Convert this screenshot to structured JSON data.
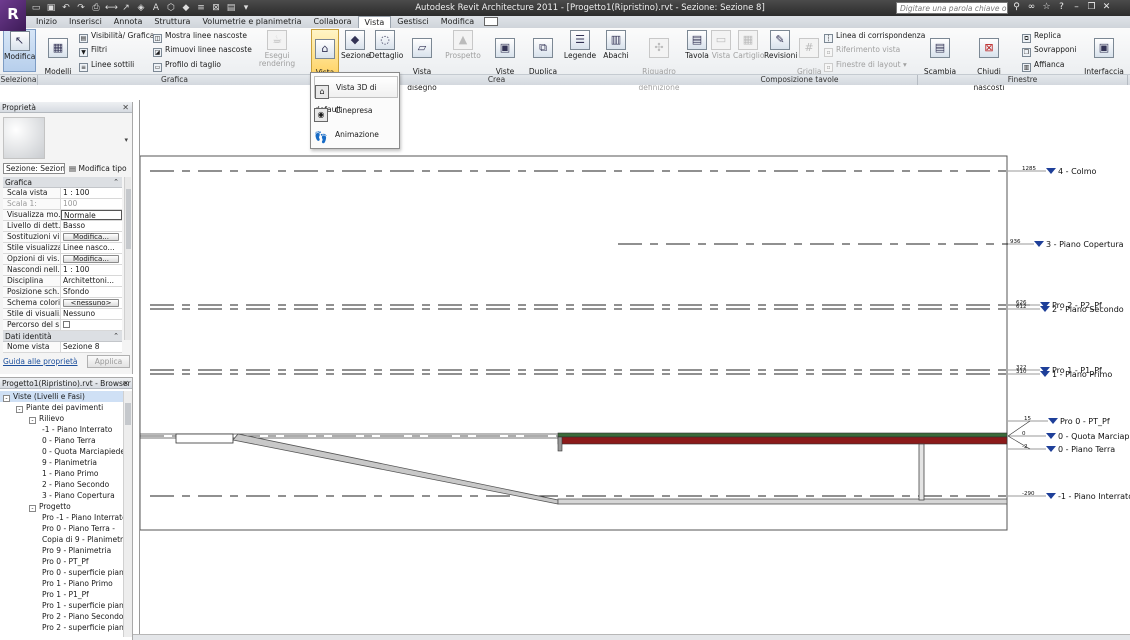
{
  "titlebar": {
    "logo": "R",
    "title": "Autodesk Revit Architecture 2011 - [Progetto1(Ripristino).rvt - Sezione: Sezione 8]",
    "help_placeholder": "Digitare una parola chiave o una frase"
  },
  "tabs": [
    {
      "label": "Inizio"
    },
    {
      "label": "Inserisci"
    },
    {
      "label": "Annota"
    },
    {
      "label": "Struttura"
    },
    {
      "label": "Volumetrie e planimetria"
    },
    {
      "label": "Collabora"
    },
    {
      "label": "Vista",
      "active": true
    },
    {
      "label": "Gestisci"
    },
    {
      "label": "Modifica"
    }
  ],
  "ribbon": {
    "modifica": "Modifica",
    "modelli_vista": "Modelli\nvista",
    "visibilita": "Visibilità/ Grafica",
    "filtri": "Filtri",
    "linee_sottili": "Linee sottili",
    "mostra_linee": "Mostra linee nascoste",
    "rimuovi_linee": "Rimuovi linee nascoste",
    "profilo_taglio": "Profilo di taglio",
    "esegui_rendering": "Esegui rendering",
    "vista3d": "Vista\n3D",
    "sezione": "Sezione",
    "dettaglio": "Dettaglio",
    "vista_disegno": "Vista\ndi disegno",
    "prospetto": "Prospetto",
    "viste_pianta": "Viste\ndi pianta",
    "duplica_vista": "Duplica\nvista",
    "legende": "Legende",
    "abachi": "Abachi",
    "riquadro": "Riquadro\ndi definizione",
    "tavola": "Tavola",
    "vista": "Vista",
    "cartiglio": "Cartiglio",
    "revisioni": "Revisioni",
    "griglia_guida": "Griglia\nguida",
    "linea_corrispondenza": "Linea di corrispondenza",
    "riferimento_vista": "Riferimento vista",
    "finestre_layout": "Finestre di layout",
    "scambia_finestre": "Scambia\nfinestre",
    "chiudi_elementi": "Chiudi\nelementi nascosti",
    "replica": "Replica",
    "sovrapponi": "Sovrapponi",
    "affianca": "Affianca",
    "interfaccia_utente": "Interfaccia\nutente"
  },
  "groups": {
    "seleziona": "Seleziona",
    "grafica": "Grafica",
    "crea": "Crea",
    "composizione": "Composizione tavole",
    "finestre": "Finestre"
  },
  "dropdown": {
    "items": [
      "Vista 3D di default",
      "Cinepresa",
      "Animazione"
    ]
  },
  "properties": {
    "title": "Proprietà",
    "type_select": "Sezione: Sezion",
    "edit_type": "Modifica tipo",
    "section_graphics": "Grafica",
    "rows": [
      {
        "k": "Scala vista",
        "v": "1 : 100"
      },
      {
        "k": "Scala 1:",
        "v": "100"
      },
      {
        "k": "Visualizza mo...",
        "v": "Normale"
      },
      {
        "k": "Livello di dett...",
        "v": "Basso"
      },
      {
        "k": "Sostituzioni vi...",
        "v": "Modifica..."
      },
      {
        "k": "Stile visualizza...",
        "v": "Linee nasco..."
      },
      {
        "k": "Opzioni di vis...",
        "v": "Modifica..."
      },
      {
        "k": "Nascondi nell...",
        "v": "1 : 100"
      },
      {
        "k": "Disciplina",
        "v": "Architettoni..."
      },
      {
        "k": "Posizione sch...",
        "v": "Sfondo"
      },
      {
        "k": "Schema colori",
        "v": "<nessuno>"
      },
      {
        "k": "Stile di visuali...",
        "v": "Nessuno"
      },
      {
        "k": "Percorso del s...",
        "v": ""
      }
    ],
    "section_identity": "Dati identità",
    "identity_rows": [
      {
        "k": "Nome vista",
        "v": "Sezione 8"
      }
    ],
    "help_link": "Guida alle proprietà",
    "apply": "Applica"
  },
  "browser": {
    "title": "Progetto1(Ripristino).rvt - Browser d...",
    "nodes": [
      {
        "label": "Viste (Livelli e Fasi)",
        "depth": 0,
        "toggle": "-"
      },
      {
        "label": "Piante dei pavimenti",
        "depth": 1,
        "toggle": "-"
      },
      {
        "label": "Rilievo",
        "depth": 2,
        "toggle": "-"
      },
      {
        "label": "-1 - Piano Interrato",
        "depth": 3
      },
      {
        "label": "0 - Piano Terra",
        "depth": 3
      },
      {
        "label": "0 - Quota Marciapiede",
        "depth": 3
      },
      {
        "label": "9 - Planimetria",
        "depth": 3
      },
      {
        "label": "1 - Piano Primo",
        "depth": 3
      },
      {
        "label": "2 - Piano Secondo",
        "depth": 3
      },
      {
        "label": "3 - Piano Copertura",
        "depth": 3
      },
      {
        "label": "Progetto",
        "depth": 2,
        "toggle": "-"
      },
      {
        "label": "Pro -1 - Piano Interrato",
        "depth": 3
      },
      {
        "label": "Pro 0 - Piano Terra -",
        "depth": 3
      },
      {
        "label": "Copia di 9 - Planimetria",
        "depth": 3
      },
      {
        "label": "Pro  9 - Planimetria",
        "depth": 3
      },
      {
        "label": "Pro 0 - PT_Pf",
        "depth": 3
      },
      {
        "label": "Pro 0 - superficie piano",
        "depth": 3
      },
      {
        "label": "Pro 1 - Piano Primo",
        "depth": 3
      },
      {
        "label": "Pro 1 - P1_Pf",
        "depth": 3
      },
      {
        "label": "Pro 1 - superficie piano",
        "depth": 3
      },
      {
        "label": "Pro 2 - Piano Secondo",
        "depth": 3
      },
      {
        "label": "Pro 2 - superficie piano",
        "depth": 3
      }
    ]
  },
  "levels": [
    {
      "name": "4 - Colmo",
      "elev": "1285"
    },
    {
      "name": "3 - Piano Copertura",
      "elev": "936"
    },
    {
      "name": "Pro 2 - P2_Pf",
      "elev": "626"
    },
    {
      "name": "2 - Piano Secondo",
      "elev": "612"
    },
    {
      "name": "Pro 1 - P1_Pf",
      "elev": "322"
    },
    {
      "name": "1 - Piano Primo",
      "elev": "310"
    },
    {
      "name": "Pro 0 - PT_Pf",
      "elev": "15"
    },
    {
      "name": "0 - Quota Marciapiede",
      "elev": "0"
    },
    {
      "name": "0 - Piano Terra",
      "elev": "-2"
    },
    {
      "name": "-1 - Piano Interrato",
      "elev": "-290"
    }
  ],
  "colors": {
    "floor_red": "#8b1a1a",
    "floor_green": "#3a6b3a",
    "level_blue": "#1e3f99"
  }
}
